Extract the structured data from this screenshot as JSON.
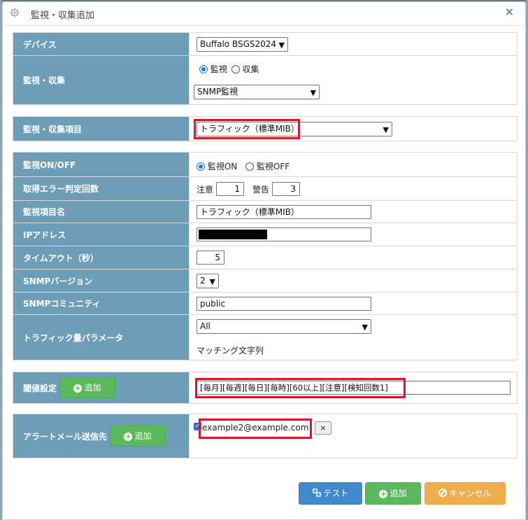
{
  "dialog": {
    "title": "監視・収集追加",
    "close": "×"
  },
  "rows": {
    "device": {
      "label": "デバイス",
      "value": "Buffalo BSGS2024"
    },
    "mode": {
      "label": "監視・収集",
      "radio1": "監視",
      "radio2": "収集",
      "select": "SNMP監視"
    },
    "item": {
      "label": "監視・収集項目",
      "select": "トラフィック（標準MIB）"
    },
    "onoff": {
      "label": "監視ON/OFF",
      "on": "監視ON",
      "off": "監視OFF"
    },
    "errcount": {
      "label": "取得エラー判定回数",
      "caution": "注意",
      "caution_value": "1",
      "warning": "警告",
      "warning_value": "3"
    },
    "itemname": {
      "label": "監視項目名",
      "value": "トラフィック（標準MIB）"
    },
    "ip": {
      "label": "IPアドレス"
    },
    "timeout": {
      "label": "タイムアウト（秒）",
      "value": "5"
    },
    "snmpver": {
      "label": "SNMPバージョン",
      "value": "2"
    },
    "community": {
      "label": "SNMPコミュニティ",
      "value": "public"
    },
    "trafficparam": {
      "label": "トラフィック量パラメータ",
      "select": "All",
      "match": "マッチング文字列"
    },
    "threshold": {
      "label": "閾値設定",
      "add": "追加",
      "value": "[毎月][毎週][毎日][毎時][60以上][注意][検知回数1]"
    },
    "alertmail": {
      "label": "アラートメール送信先",
      "add": "追加",
      "email": "example2@example.com",
      "remove": "×"
    }
  },
  "footer": {
    "test": "テスト",
    "add": "追加",
    "cancel": "キャンセル"
  },
  "colors": {
    "label_bg": "#6e9db7",
    "highlight": "#d9142b",
    "green": "#5cb85c",
    "blue": "#428bca",
    "orange": "#f0ad4e"
  }
}
